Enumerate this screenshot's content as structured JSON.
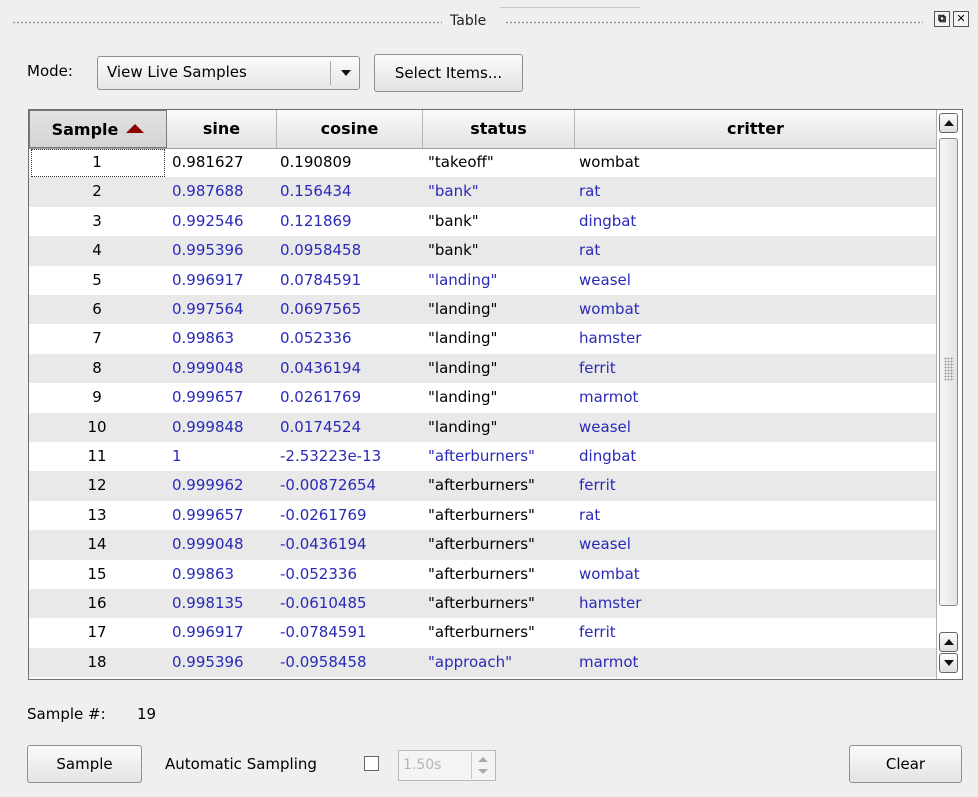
{
  "window": {
    "title": "Table",
    "float_icon": "float-icon",
    "close_icon": "close-icon"
  },
  "mode": {
    "label": "Mode:",
    "selected": "View Live Samples",
    "select_items_label": "Select Items..."
  },
  "table": {
    "columns": [
      "Sample",
      "sine",
      "cosine",
      "status",
      "critter"
    ],
    "sorted_column": "Sample",
    "sort_direction": "ascending",
    "highlight_color": "#2a2ab8",
    "rows": [
      {
        "sample": "1",
        "sine": "0.981627",
        "cosine": "0.190809",
        "status": "\"takeoff\"",
        "critter": "wombat",
        "changed": []
      },
      {
        "sample": "2",
        "sine": "0.987688",
        "cosine": "0.156434",
        "status": "\"bank\"",
        "critter": "rat",
        "changed": [
          "sine",
          "cosine",
          "status",
          "critter"
        ]
      },
      {
        "sample": "3",
        "sine": "0.992546",
        "cosine": "0.121869",
        "status": "\"bank\"",
        "critter": "dingbat",
        "changed": [
          "sine",
          "cosine",
          "critter"
        ]
      },
      {
        "sample": "4",
        "sine": "0.995396",
        "cosine": "0.0958458",
        "status": "\"bank\"",
        "critter": "rat",
        "changed": [
          "sine",
          "cosine",
          "critter"
        ]
      },
      {
        "sample": "5",
        "sine": "0.996917",
        "cosine": "0.0784591",
        "status": "\"landing\"",
        "critter": "weasel",
        "changed": [
          "sine",
          "cosine",
          "status",
          "critter"
        ]
      },
      {
        "sample": "6",
        "sine": "0.997564",
        "cosine": "0.0697565",
        "status": "\"landing\"",
        "critter": "wombat",
        "changed": [
          "sine",
          "cosine",
          "critter"
        ]
      },
      {
        "sample": "7",
        "sine": "0.99863",
        "cosine": "0.052336",
        "status": "\"landing\"",
        "critter": "hamster",
        "changed": [
          "sine",
          "cosine",
          "critter"
        ]
      },
      {
        "sample": "8",
        "sine": "0.999048",
        "cosine": "0.0436194",
        "status": "\"landing\"",
        "critter": "ferrit",
        "changed": [
          "sine",
          "cosine",
          "critter"
        ]
      },
      {
        "sample": "9",
        "sine": "0.999657",
        "cosine": "0.0261769",
        "status": "\"landing\"",
        "critter": "marmot",
        "changed": [
          "sine",
          "cosine",
          "critter"
        ]
      },
      {
        "sample": "10",
        "sine": "0.999848",
        "cosine": "0.0174524",
        "status": "\"landing\"",
        "critter": "weasel",
        "changed": [
          "sine",
          "cosine",
          "critter"
        ]
      },
      {
        "sample": "11",
        "sine": "1",
        "cosine": "-2.53223e-13",
        "status": "\"afterburners\"",
        "critter": "dingbat",
        "changed": [
          "sine",
          "cosine",
          "status",
          "critter"
        ]
      },
      {
        "sample": "12",
        "sine": "0.999962",
        "cosine": "-0.00872654",
        "status": "\"afterburners\"",
        "critter": "ferrit",
        "changed": [
          "sine",
          "cosine",
          "critter"
        ]
      },
      {
        "sample": "13",
        "sine": "0.999657",
        "cosine": "-0.0261769",
        "status": "\"afterburners\"",
        "critter": "rat",
        "changed": [
          "sine",
          "cosine",
          "critter"
        ]
      },
      {
        "sample": "14",
        "sine": "0.999048",
        "cosine": "-0.0436194",
        "status": "\"afterburners\"",
        "critter": "weasel",
        "changed": [
          "sine",
          "cosine",
          "critter"
        ]
      },
      {
        "sample": "15",
        "sine": "0.99863",
        "cosine": "-0.052336",
        "status": "\"afterburners\"",
        "critter": "wombat",
        "changed": [
          "sine",
          "cosine",
          "critter"
        ]
      },
      {
        "sample": "16",
        "sine": "0.998135",
        "cosine": "-0.0610485",
        "status": "\"afterburners\"",
        "critter": "hamster",
        "changed": [
          "sine",
          "cosine",
          "critter"
        ]
      },
      {
        "sample": "17",
        "sine": "0.996917",
        "cosine": "-0.0784591",
        "status": "\"afterburners\"",
        "critter": "ferrit",
        "changed": [
          "sine",
          "cosine",
          "critter"
        ]
      },
      {
        "sample": "18",
        "sine": "0.995396",
        "cosine": "-0.0958458",
        "status": "\"approach\"",
        "critter": "marmot",
        "changed": [
          "sine",
          "cosine",
          "status",
          "critter"
        ]
      }
    ]
  },
  "footer": {
    "sample_number_label": "Sample #:",
    "sample_number_value": "19",
    "sample_button": "Sample",
    "auto_sampling_label": "Automatic Sampling",
    "auto_sampling_checked": false,
    "interval_value": "1.50s",
    "clear_button": "Clear"
  }
}
